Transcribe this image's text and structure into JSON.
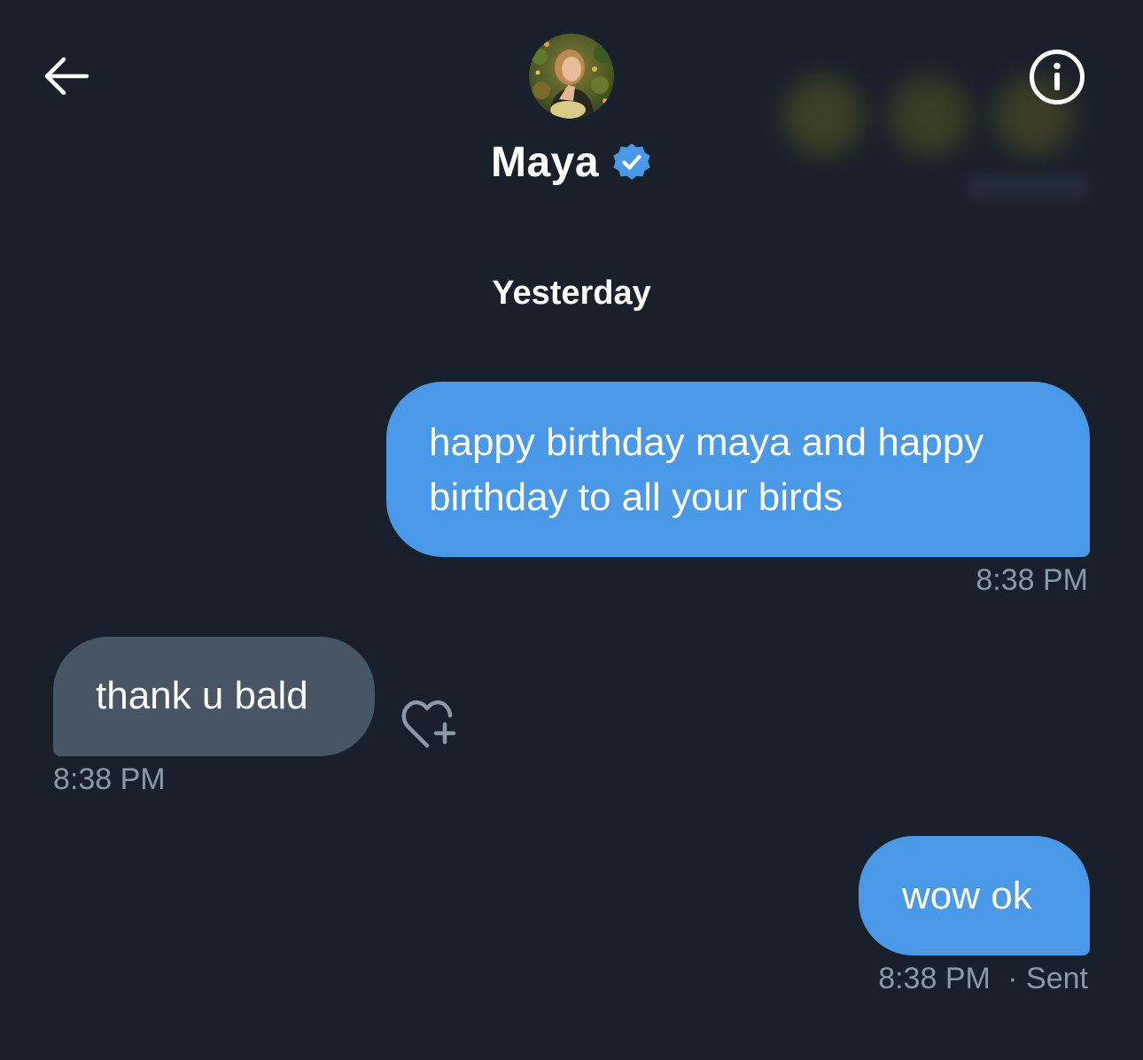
{
  "header": {
    "contact_name": "Maya",
    "verified": true,
    "back_icon": "arrow-left-icon",
    "info_icon": "info-circle-icon"
  },
  "conversation": {
    "date_separator": "Yesterday",
    "messages": [
      {
        "direction": "outgoing",
        "text": "happy birthday maya and happy birthday to all your birds",
        "time": "8:38 PM"
      },
      {
        "direction": "incoming",
        "text": "thank u bald",
        "time": "8:38 PM",
        "reaction_icon": "heart-plus-icon"
      },
      {
        "direction": "outgoing",
        "text": "wow ok",
        "time": "8:38 PM",
        "status": "· Sent"
      }
    ]
  },
  "colors": {
    "background": "#18202b",
    "outgoing_bubble": "#4a99e8",
    "incoming_bubble": "#475565",
    "timestamp": "#8b98a5",
    "verified_badge": "#4a99e8"
  }
}
